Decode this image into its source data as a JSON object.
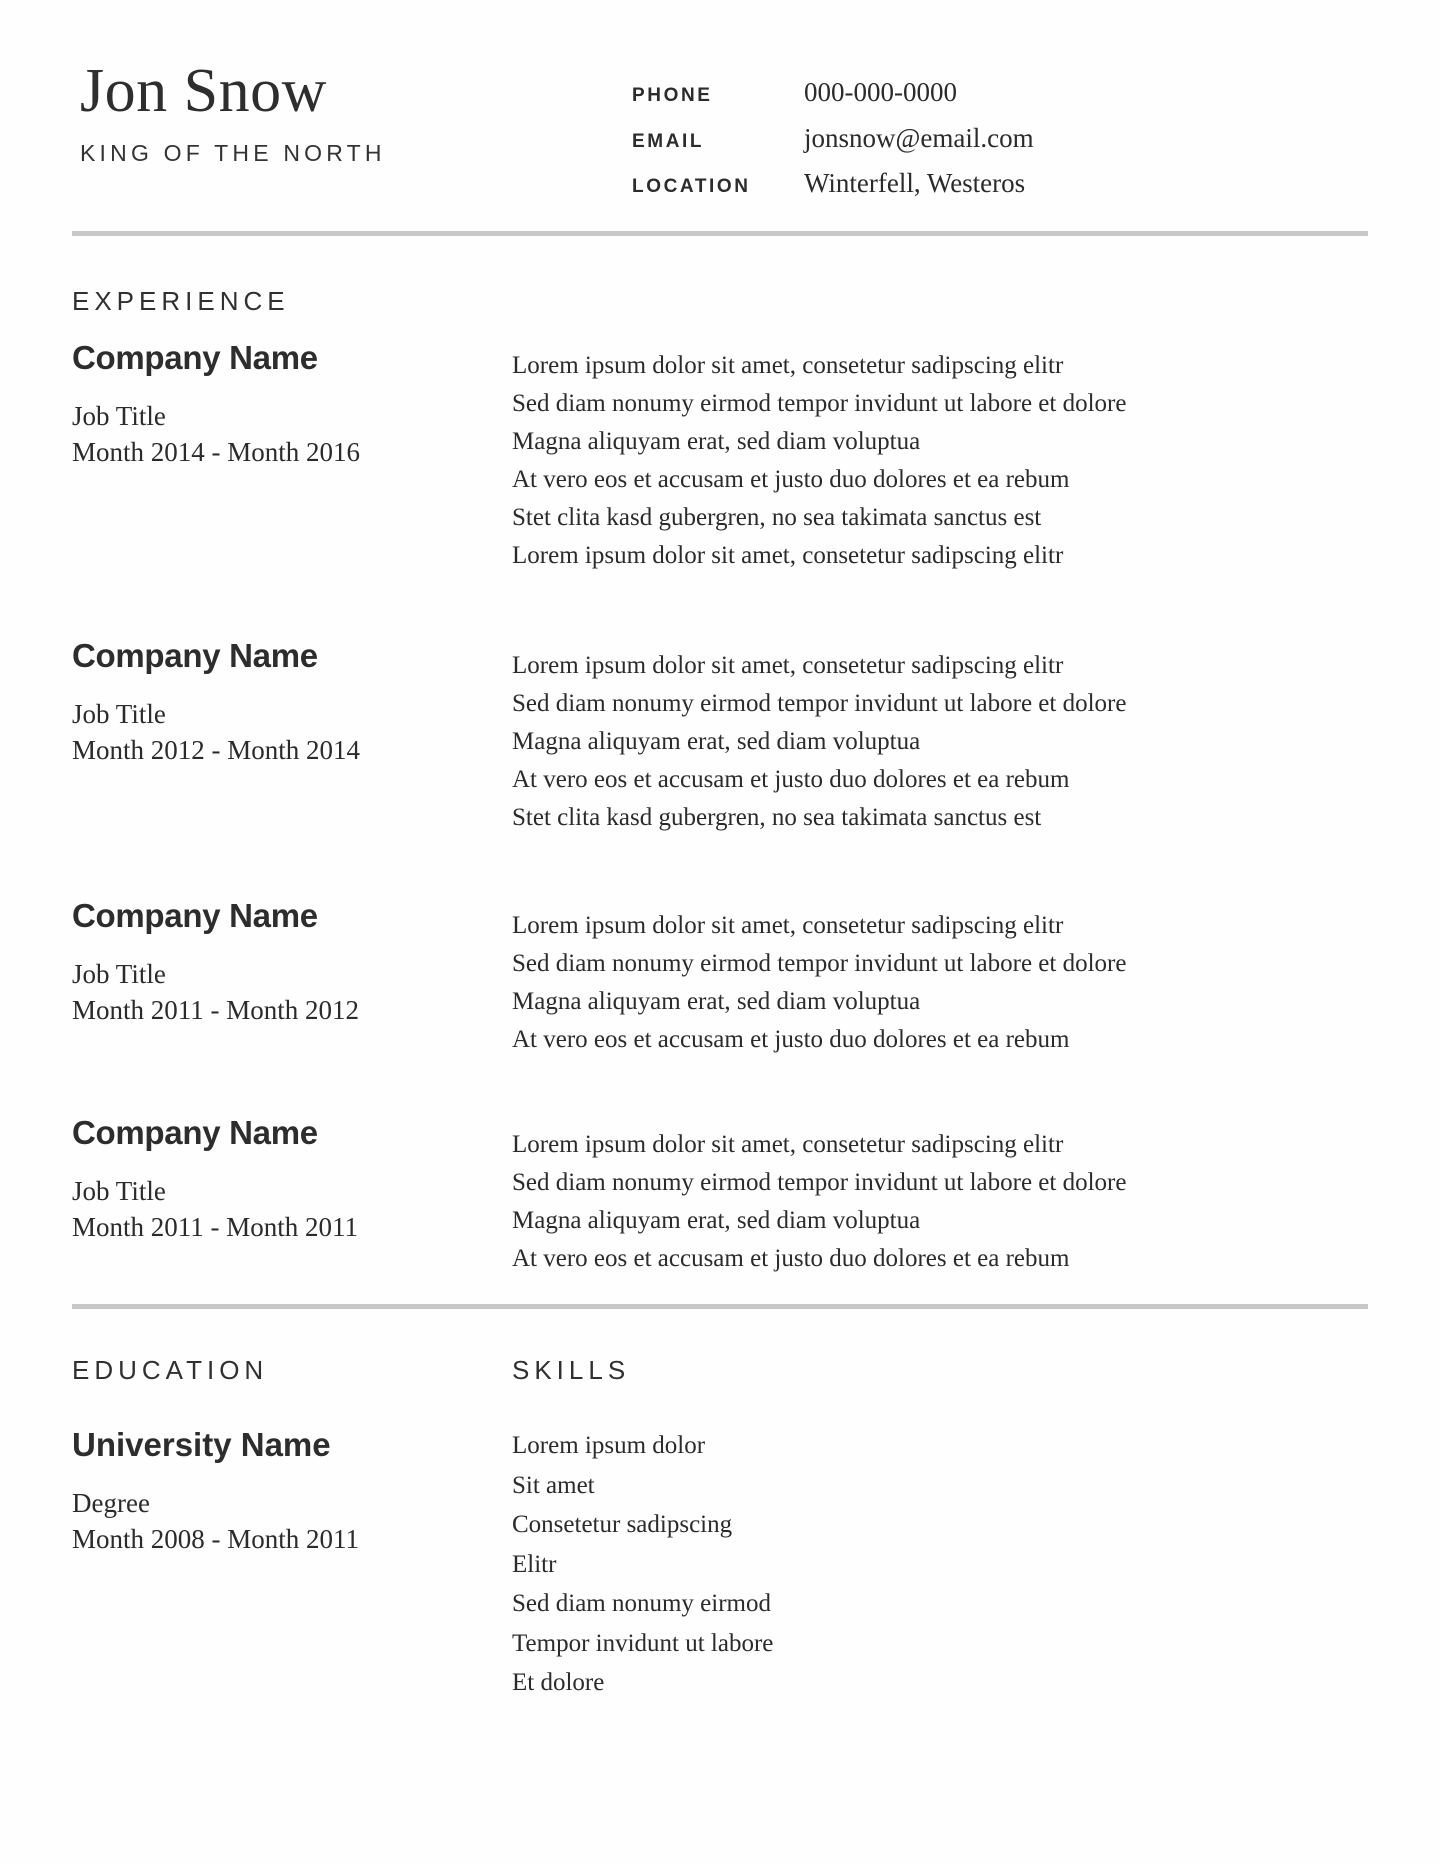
{
  "document": {
    "type": "resume",
    "accent_rule_color": "#c8c8c8",
    "text_color": "#2b2b2b"
  },
  "header": {
    "full_name": "Jon Snow",
    "tagline": "KING OF THE NORTH",
    "contacts": [
      {
        "label": "PHONE",
        "value": "000-000-0000"
      },
      {
        "label": "EMAIL",
        "value": "jonsnow@email.com"
      },
      {
        "label": "LOCATION",
        "value": "Winterfell, Westeros"
      }
    ]
  },
  "experience": {
    "title": "EXPERIENCE",
    "entries": [
      {
        "company": "Company Name",
        "job_title": "Job Title",
        "dates": "Month 2014 - Month 2016",
        "description": [
          "Lorem ipsum dolor sit amet, consetetur sadipscing elitr",
          "Sed diam nonumy eirmod tempor invidunt ut labore et dolore",
          "Magna aliquyam erat, sed diam voluptua",
          "At vero eos et accusam et justo duo dolores et ea rebum",
          "Stet clita kasd gubergren, no sea takimata sanctus est",
          "Lorem ipsum dolor sit amet, consetetur sadipscing elitr"
        ]
      },
      {
        "company": "Company Name",
        "job_title": "Job Title",
        "dates": "Month 2012 - Month 2014",
        "description": [
          "Lorem ipsum dolor sit amet, consetetur sadipscing elitr",
          "Sed diam nonumy eirmod tempor invidunt ut labore et dolore",
          "Magna aliquyam erat, sed diam voluptua",
          "At vero eos et accusam et justo duo dolores et ea rebum",
          "Stet clita kasd gubergren, no sea takimata sanctus est"
        ]
      },
      {
        "company": "Company Name",
        "job_title": "Job Title",
        "dates": "Month 2011 - Month 2012",
        "description": [
          "Lorem ipsum dolor sit amet, consetetur sadipscing elitr",
          "Sed diam nonumy eirmod tempor invidunt ut labore et dolore",
          "Magna aliquyam erat, sed diam voluptua",
          "At vero eos et accusam et justo duo dolores et ea rebum"
        ]
      },
      {
        "company": "Company Name",
        "job_title": "Job Title",
        "dates": "Month 2011 - Month 2011",
        "description": [
          "Lorem ipsum dolor sit amet, consetetur sadipscing elitr",
          "Sed diam nonumy eirmod tempor invidunt ut labore et dolore",
          "Magna aliquyam erat, sed diam voluptua",
          "At vero eos et accusam et justo duo dolores et ea rebum"
        ]
      }
    ]
  },
  "education": {
    "title": "EDUCATION",
    "school": "University Name",
    "degree": "Degree",
    "dates": "Month 2008 - Month 2011"
  },
  "skills": {
    "title": "SKILLS",
    "items": [
      "Lorem ipsum dolor",
      "Sit amet",
      "Consetetur sadipscing",
      "Elitr",
      "Sed diam nonumy eirmod",
      "Tempor invidunt ut labore",
      "Et dolore"
    ]
  }
}
